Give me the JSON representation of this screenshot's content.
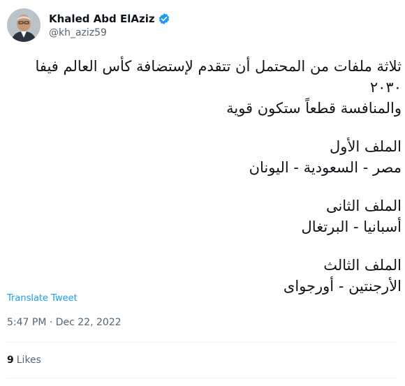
{
  "author": {
    "display_name": "Khaled Abd ElAziz",
    "handle": "@kh_aziz59",
    "verified_icon": "verified-badge-icon",
    "avatar": "profile-photo"
  },
  "tweet": {
    "lines": [
      "ثلاثة ملفات من المحتمل أن تتقدم لإستضافة كأس العالم فيفا",
      "٢٠٣٠",
      "والمنافسة قطعاً ستكون قوية",
      "الملف الأول",
      "مصر - السعودية - اليونان",
      "الملف الثانى",
      "أسبانيا - البرتغال",
      "الملف الثالث",
      "الأرجنتين - أورجواى"
    ]
  },
  "translate_label": "Translate Tweet",
  "timestamp": "5:47 PM · Dec 22, 2022",
  "likes": {
    "count": "9",
    "label": "Likes"
  },
  "colors": {
    "accent": "#1d9bf0",
    "secondary_text": "#536471",
    "text": "#0f1419"
  }
}
